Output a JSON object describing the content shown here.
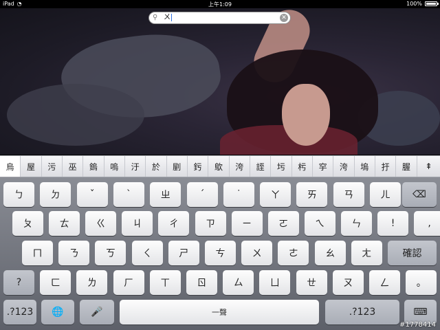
{
  "status_bar": {
    "time": "上午1:09",
    "battery_percent": "100%",
    "battery_level": 1.0
  },
  "search": {
    "value": "ㄨ",
    "icon": "search-icon",
    "clear_icon": "clear-icon"
  },
  "candidates": [
    "烏",
    "屋",
    "污",
    "巫",
    "鎢",
    "嗚",
    "汙",
    "於",
    "剭",
    "釫",
    "歍",
    "洿",
    "誈",
    "圬",
    "杇",
    "穻",
    "洿",
    "塢",
    "扜",
    "腛"
  ],
  "candidate_expand": "⇞",
  "keyboard": {
    "rows": [
      [
        "ㄅ",
        "ㄉ",
        "ˇ",
        "ˋ",
        "ㄓ",
        "ˊ",
        "˙",
        "ㄚ",
        "ㄞ",
        "ㄢ",
        "ㄦ"
      ],
      [
        "ㄆ",
        "ㄊ",
        "ㄍ",
        "ㄐ",
        "ㄔ",
        "ㄗ",
        "ㄧ",
        "ㄛ",
        "ㄟ",
        "ㄣ",
        "!",
        ","
      ],
      [
        "ㄇ",
        "ㄋ",
        "ㄎ",
        "ㄑ",
        "ㄕ",
        "ㄘ",
        "ㄨ",
        "ㄜ",
        "ㄠ",
        "ㄤ"
      ],
      [
        "?",
        "ㄈ",
        "ㄌ",
        "ㄏ",
        "ㄒ",
        "ㄖ",
        "ㄙ",
        "ㄩ",
        "ㄝ",
        "ㄡ",
        "ㄥ",
        "。"
      ]
    ],
    "delete_label": "⌫",
    "confirm_label": "確認",
    "num_label": ".?123",
    "globe_label": "🌐",
    "mic_label": "🎤",
    "space_label": "一聲",
    "hide_label": "⌨"
  },
  "watermark": "#1778414",
  "colors": {
    "accent": "#2d6fe0"
  }
}
